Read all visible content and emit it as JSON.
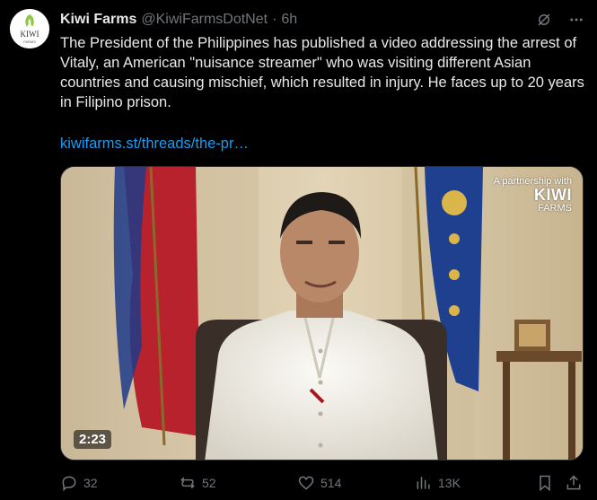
{
  "author": {
    "display_name": "Kiwi Farms",
    "handle": "@KiwiFarmsDotNet",
    "separator": "·",
    "time": "6h",
    "avatar_text": "KIWI",
    "avatar_subtext": "FARMS"
  },
  "tweet": {
    "text": "The President of the Philippines has published a video addressing the arrest of Vitaly, an American \"nuisance streamer\" who was visiting different Asian countries and causing mischief, which resulted in injury. He faces up to 20 years in Filipino prison.",
    "link": "kiwifarms.st/threads/the-pr…"
  },
  "media": {
    "duration": "2:23",
    "watermark_top": "A partnership with",
    "watermark_brand": "KIWI",
    "watermark_sub": "FARMS"
  },
  "actions": {
    "replies": "32",
    "reposts": "52",
    "likes": "514",
    "views": "13K"
  },
  "colors": {
    "background": "#000000",
    "text": "#e7e9ea",
    "muted": "#71767b",
    "link": "#1d9bf0",
    "kiwi_green": "#8dc63f"
  }
}
